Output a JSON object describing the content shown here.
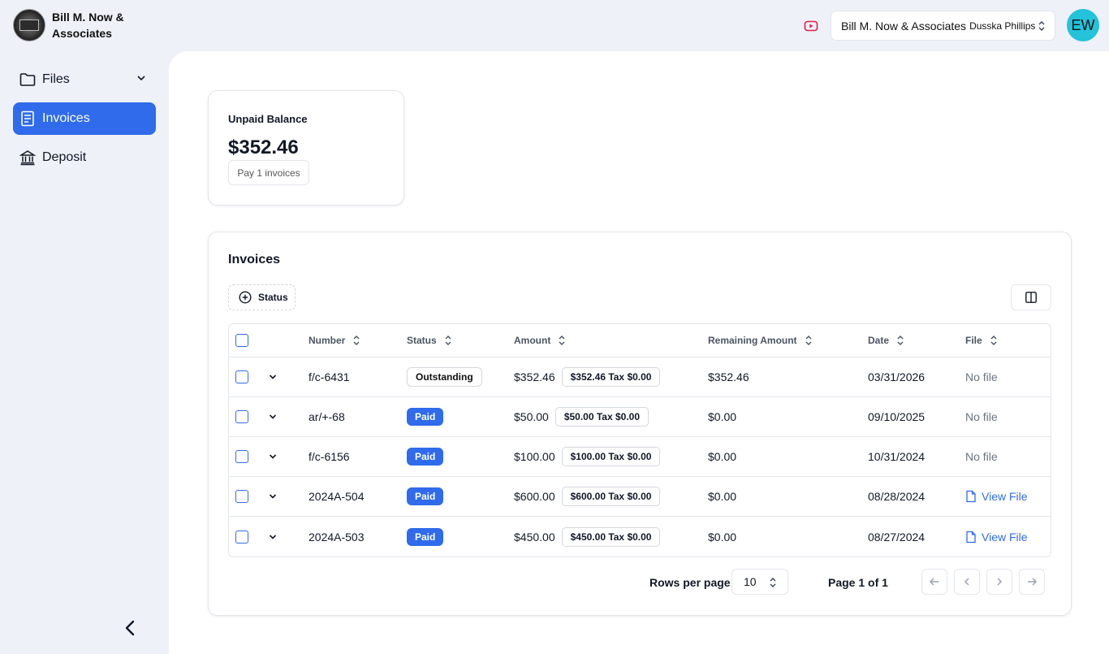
{
  "brand": {
    "name": "Bill M. Now & Associates"
  },
  "sidebar": {
    "items": [
      {
        "label": "Files",
        "icon": "folder-icon"
      },
      {
        "label": "Invoices",
        "icon": "invoice-icon",
        "active": true
      },
      {
        "label": "Deposit",
        "icon": "bank-icon"
      }
    ]
  },
  "header": {
    "org_name": "Bill M. Now & Associates",
    "user_name": "Dusska Phillips",
    "avatar_initials": "EW",
    "avatar_color": "#22c3db",
    "video_icon_color": "#e11d48"
  },
  "balance": {
    "title": "Unpaid Balance",
    "amount": "$352.46",
    "pay_label": "Pay 1 invoices"
  },
  "invoices": {
    "title": "Invoices",
    "filter_label": "Status",
    "columns": [
      "Number",
      "Status",
      "Amount",
      "Remaining Amount",
      "Date",
      "File"
    ],
    "rows": [
      {
        "number": "f/c-6431",
        "status": "Outstanding",
        "amount": "$352.46",
        "amount_detail": "$352.46 Tax $0.00",
        "remaining": "$352.46",
        "date": "03/31/2026",
        "file": "No file"
      },
      {
        "number": "ar/+-68",
        "status": "Paid",
        "amount": "$50.00",
        "amount_detail": "$50.00 Tax $0.00",
        "remaining": "$0.00",
        "date": "09/10/2025",
        "file": "No file"
      },
      {
        "number": "f/c-6156",
        "status": "Paid",
        "amount": "$100.00",
        "amount_detail": "$100.00 Tax $0.00",
        "remaining": "$0.00",
        "date": "10/31/2024",
        "file": "No file"
      },
      {
        "number": "2024A-504",
        "status": "Paid",
        "amount": "$600.00",
        "amount_detail": "$600.00 Tax $0.00",
        "remaining": "$0.00",
        "date": "08/28/2024",
        "file": "View File"
      },
      {
        "number": "2024A-503",
        "status": "Paid",
        "amount": "$450.00",
        "amount_detail": "$450.00 Tax $0.00",
        "remaining": "$0.00",
        "date": "08/27/2024",
        "file": "View File"
      }
    ]
  },
  "pagination": {
    "rows_per_page_label": "Rows per page",
    "rows_per_page": "10",
    "page_label": "Page 1 of 1"
  },
  "colors": {
    "accent": "#2f6bea",
    "background": "#eef1f7"
  }
}
